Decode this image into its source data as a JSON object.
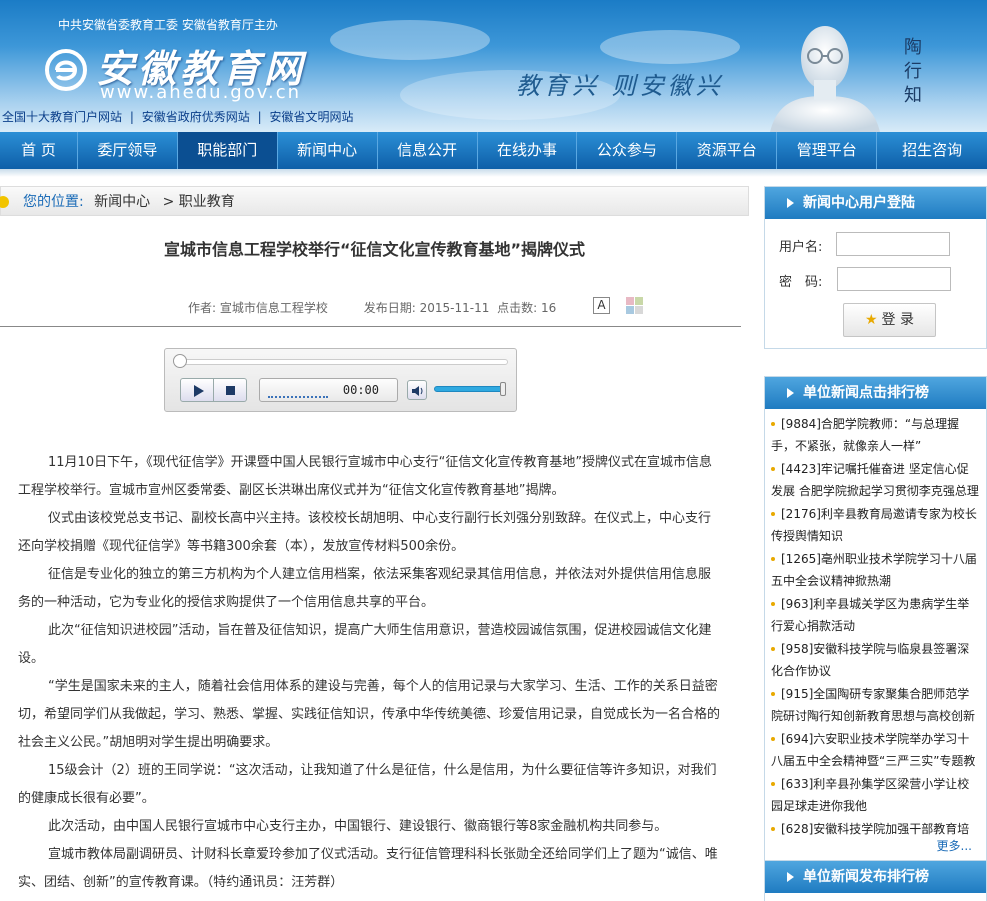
{
  "header": {
    "sponsor": "中共安徽省委教育工委  安徽省教育厅主办",
    "logo_text": "安徽教育网",
    "logo_url": "www.ahedu.gov.cn",
    "top_links": [
      "全国十大教育门户网站",
      "安徽省政府优秀网站",
      "安徽省文明网站"
    ],
    "link_sep": "|",
    "slogan": "教育兴 则安徽兴",
    "portrait_name": "陶行知"
  },
  "nav": {
    "items": [
      "首 页",
      "委厅领导",
      "职能部门",
      "新闻中心",
      "信息公开",
      "在线办事",
      "公众参与",
      "资源平台",
      "管理平台",
      "招生咨询"
    ],
    "active": "职能部门"
  },
  "breadcrumb": {
    "label": "您的位置:",
    "path": [
      "新闻中心",
      "> 职业教育"
    ]
  },
  "article": {
    "title": "宣城市信息工程学校举行“征信文化宣传教育基地”揭牌仪式",
    "author_label": "作者:",
    "author": "宣城市信息工程学校",
    "date_label": "发布日期:",
    "date": "2015-11-11",
    "clicks_label": "点击数:",
    "clicks": "16",
    "font_toggle": "A",
    "paragraphs": [
      "11月10日下午，《现代征信学》开课暨中国人民银行宣城市中心支行“征信文化宣传教育基地”授牌仪式在宣城市信息工程学校举行。宣城市宣州区委常委、副区长洪琳出席仪式并为“征信文化宣传教育基地”揭牌。",
      "仪式由该校党总支书记、副校长高中兴主持。该校校长胡旭明、中心支行副行长刘强分别致辞。在仪式上，中心支行还向学校捐赠《现代征信学》等书籍300余套（本），发放宣传材料500余份。",
      "征信是专业化的独立的第三方机构为个人建立信用档案，依法采集客观纪录其信用信息，并依法对外提供信用信息服务的一种活动，它为专业化的授信求购提供了一个信用信息共享的平台。",
      "此次“征信知识进校园”活动，旨在普及征信知识，提高广大师生信用意识，营造校园诚信氛围，促进校园诚信文化建设。",
      "“学生是国家未来的主人，随着社会信用体系的建设与完善，每个人的信用记录与大家学习、生活、工作的关系日益密切，希望同学们从我做起，学习、熟悉、掌握、实践征信知识，传承中华传统美德、珍爱信用记录，自觉成长为一名合格的社会主义公民。”胡旭明对学生提出明确要求。",
      "15级会计（2）班的王同学说：“这次活动，让我知道了什么是征信，什么是信用，为什么要征信等许多知识，对我们的健康成长很有必要”。",
      "此次活动，由中国人民银行宣城市中心支行主办，中国银行、建设银行、徽商银行等8家金融机构共同参与。",
      "宣城市教体局副调研员、计财科长章爱玲参加了仪式活动。支行征信管理科科长张勋全还给同学们上了题为“诚信、唯实、团结、创新”的宣传教育课。（特约通讯员：汪芳群）"
    ]
  },
  "player": {
    "time": "00:00",
    "progress": 0,
    "volume": 1.0
  },
  "sidebar": {
    "login": {
      "title": "新闻中心用户登陆",
      "username_label": "用户名:",
      "password_label": "密　码:",
      "button": "登 录"
    },
    "rank": {
      "title": "单位新闻点击排行榜",
      "items": [
        "[9884]合肥学院教师：“与总理握手，不紧张，就像亲人一样”",
        "[4423]牢记嘱托催奋进 坚定信心促发展 合肥学院掀起学习贯彻李克强总理",
        "[2176]利辛县教育局邀请专家为校长传授舆情知识",
        "[1265]亳州职业技术学院学习十八届五中全会议精神掀热潮",
        "[963]利辛县城关学区为患病学生举行爱心捐款活动",
        "[958]安徽科技学院与临泉县签署深化合作协议",
        "[915]全国陶研专家聚集合肥师范学院研讨陶行知创新教育思想与高校创新",
        "[694]六安职业技术学院举办学习十八届五中全会精神暨“三严三实”专题教",
        "[633]利辛县孙集学区梁营小学让校园足球走进你我他",
        "[628]安徽科技学院加强干部教育培"
      ],
      "more": "更多..."
    },
    "publish": {
      "title": "单位新闻发布排行榜"
    }
  },
  "colors": {
    "nav_bg": "#1a74bf",
    "link": "#1a6bb7",
    "bullet": "#e8a900"
  }
}
